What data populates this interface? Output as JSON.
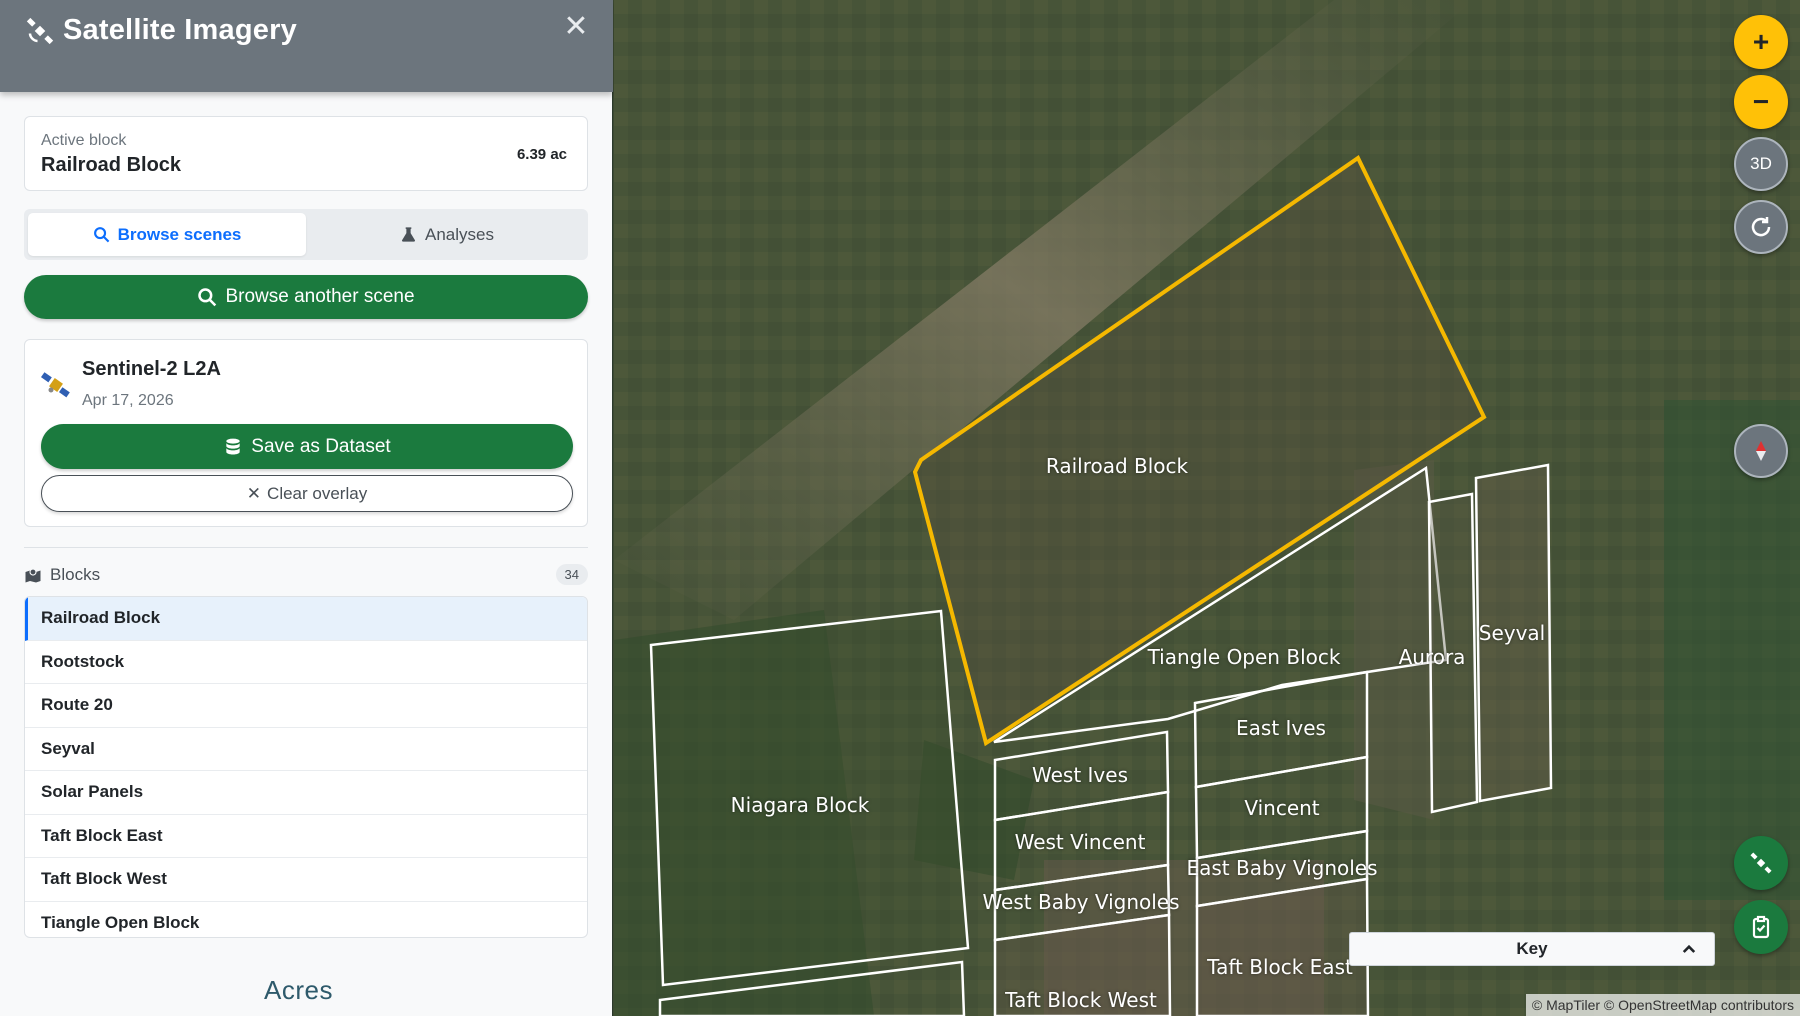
{
  "header": {
    "title": "Satellite Imagery",
    "close_glyph": "✕"
  },
  "active_block": {
    "label": "Active block",
    "name": "Railroad Block",
    "area": "6.39 ac"
  },
  "tabs": [
    {
      "label": "Browse scenes",
      "icon": "search-icon",
      "active": true
    },
    {
      "label": "Analyses",
      "icon": "flask-icon",
      "active": false
    }
  ],
  "browse_button": {
    "label": "Browse another scene"
  },
  "scene": {
    "name": "Sentinel-2 L2A",
    "date": "Apr 17, 2026",
    "save_label": "Save as Dataset",
    "clear_label": "Clear overlay"
  },
  "blocks": {
    "heading": "Blocks",
    "count": "34",
    "items": [
      "Railroad Block",
      "Rootstock",
      "Route 20",
      "Seyval",
      "Solar Panels",
      "Taft Block East",
      "Taft Block West",
      "Tiangle Open Block"
    ],
    "selected": "Railroad Block"
  },
  "logo": "Acres",
  "map": {
    "labels": {
      "railroad": "Railroad Block",
      "tiangle": "Tiangle Open Block",
      "aurora": "Aurora",
      "seyval": "Seyval",
      "niagara": "Niagara Block",
      "east_ives": "East Ives",
      "west_ives": "West Ives",
      "vincent": "Vincent",
      "west_vincent": "West Vincent",
      "east_baby": "East Baby Vignoles",
      "west_baby": "West Baby Vignoles",
      "taft_east": "Taft Block East",
      "taft_west": "Taft Block West"
    },
    "controls": {
      "zoom_in": "+",
      "zoom_out": "−",
      "three_d": "3D"
    },
    "key_label": "Key",
    "attribution": "© MapTiler © OpenStreetMap contributors",
    "highlight_color": "#f5b800"
  }
}
